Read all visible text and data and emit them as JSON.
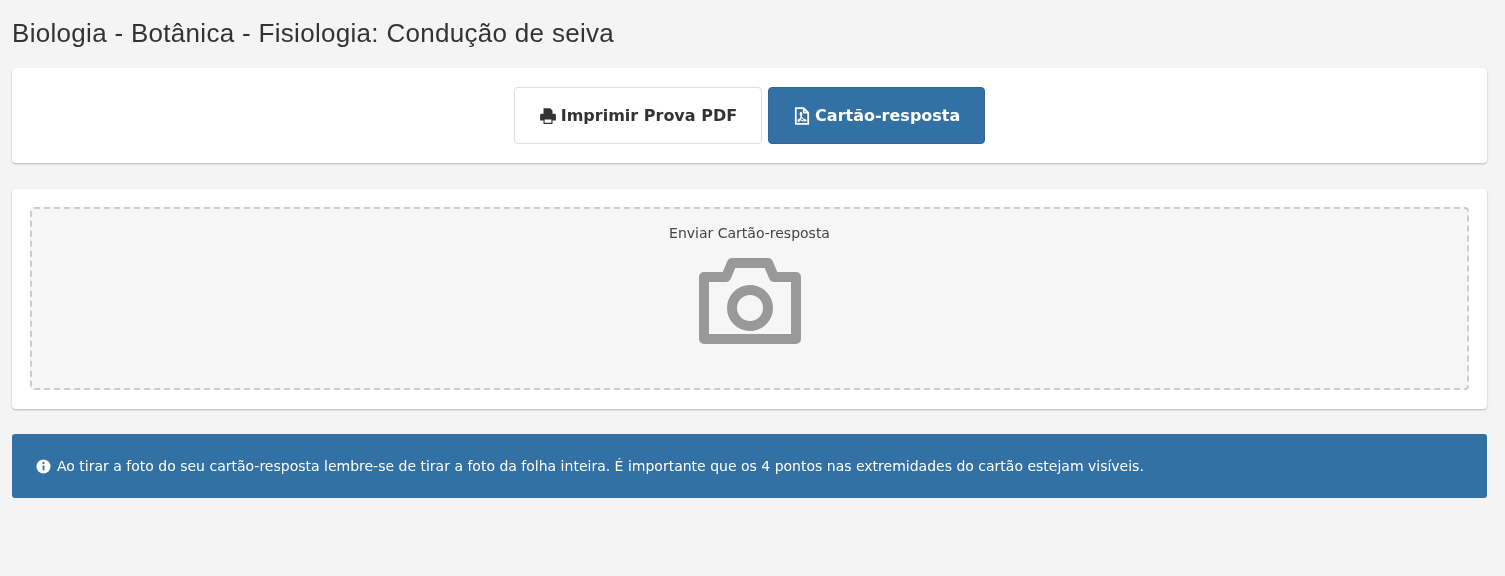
{
  "page_title": "Biologia - Botânica - Fisiologia: Condução de seiva",
  "buttons": [
    {
      "label": "Imprimir Prova PDF",
      "kind": "default"
    },
    {
      "label": "Cartão-resposta",
      "kind": "primary"
    }
  ],
  "upload": {
    "label": "Enviar Cartão-resposta"
  },
  "info_message": "Ao tirar a foto do seu cartão-resposta lembre-se de tirar a foto da folha inteira. É importante que os 4 pontos nas extremidades do cartão estejam visíveis."
}
